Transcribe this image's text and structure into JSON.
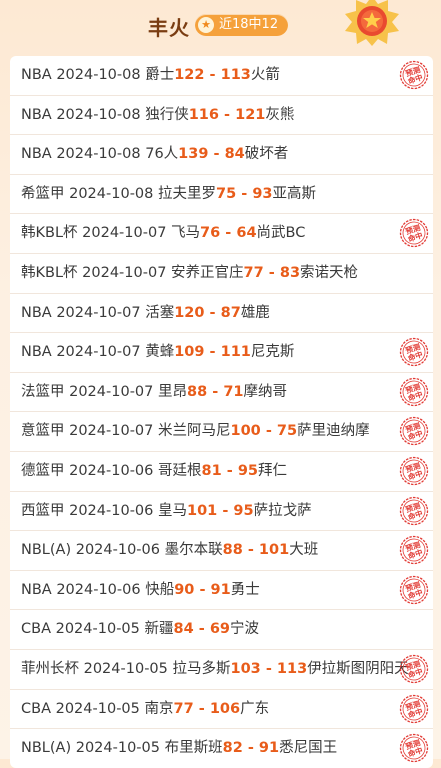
{
  "header": {
    "title": "丰火",
    "badge_text": "近18中12"
  },
  "colors": {
    "score": "#e85c1a",
    "stamp": "#e23b35",
    "badge": "#f5a13b"
  },
  "stamp_text": [
    "预测",
    "命中"
  ],
  "games": [
    {
      "league": "NBA",
      "date": "2024-10-08",
      "home": "爵士",
      "home_score": "122",
      "away_score": "113",
      "away": "火箭",
      "hit": true
    },
    {
      "league": "NBA",
      "date": "2024-10-08",
      "home": "独行侠",
      "home_score": "116",
      "away_score": "121",
      "away": "灰熊",
      "hit": false
    },
    {
      "league": "NBA",
      "date": "2024-10-08",
      "home": "76人",
      "home_score": "139",
      "away_score": "84",
      "away": "破坏者",
      "hit": false
    },
    {
      "league": "希篮甲",
      "date": "2024-10-08",
      "home": "拉夫里罗",
      "home_score": "75",
      "away_score": "93",
      "away": "亚高斯",
      "hit": false
    },
    {
      "league": "韩KBL杯",
      "date": "2024-10-07",
      "home": "飞马",
      "home_score": "76",
      "away_score": "64",
      "away": "尚武BC",
      "hit": true
    },
    {
      "league": "韩KBL杯",
      "date": "2024-10-07",
      "home": "安养正官庄",
      "home_score": "77",
      "away_score": "83",
      "away": "索诺天枪",
      "hit": false
    },
    {
      "league": "NBA",
      "date": "2024-10-07",
      "home": "活塞",
      "home_score": "120",
      "away_score": "87",
      "away": "雄鹿",
      "hit": false
    },
    {
      "league": "NBA",
      "date": "2024-10-07",
      "home": "黄蜂",
      "home_score": "109",
      "away_score": "111",
      "away": "尼克斯",
      "hit": true
    },
    {
      "league": "法篮甲",
      "date": "2024-10-07",
      "home": "里昂",
      "home_score": "88",
      "away_score": "71",
      "away": "摩纳哥",
      "hit": true
    },
    {
      "league": "意篮甲",
      "date": "2024-10-07",
      "home": "米兰阿马尼",
      "home_score": "100",
      "away_score": "75",
      "away": "萨里迪纳摩",
      "hit": true
    },
    {
      "league": "德篮甲",
      "date": "2024-10-06",
      "home": "哥廷根",
      "home_score": "81",
      "away_score": "95",
      "away": "拜仁",
      "hit": true
    },
    {
      "league": "西篮甲",
      "date": "2024-10-06",
      "home": "皇马",
      "home_score": "101",
      "away_score": "95",
      "away": "萨拉戈萨",
      "hit": true
    },
    {
      "league": "NBL(A)",
      "date": "2024-10-06",
      "home": "墨尔本联",
      "home_score": "88",
      "away_score": "101",
      "away": "大班",
      "hit": true
    },
    {
      "league": "NBA",
      "date": "2024-10-06",
      "home": "快船",
      "home_score": "90",
      "away_score": "91",
      "away": "勇士",
      "hit": true
    },
    {
      "league": "CBA",
      "date": "2024-10-05",
      "home": "新疆",
      "home_score": "84",
      "away_score": "69",
      "away": "宁波",
      "hit": false
    },
    {
      "league": "菲州长杯",
      "date": "2024-10-05",
      "home": "拉马多斯",
      "home_score": "103",
      "away_score": "113",
      "away": "伊拉斯图阴阳天",
      "hit": true
    },
    {
      "league": "CBA",
      "date": "2024-10-05",
      "home": "南京",
      "home_score": "77",
      "away_score": "106",
      "away": "广东",
      "hit": true
    },
    {
      "league": "NBL(A)",
      "date": "2024-10-05",
      "home": "布里斯班",
      "home_score": "82",
      "away_score": "91",
      "away": "悉尼国王",
      "hit": true
    }
  ]
}
